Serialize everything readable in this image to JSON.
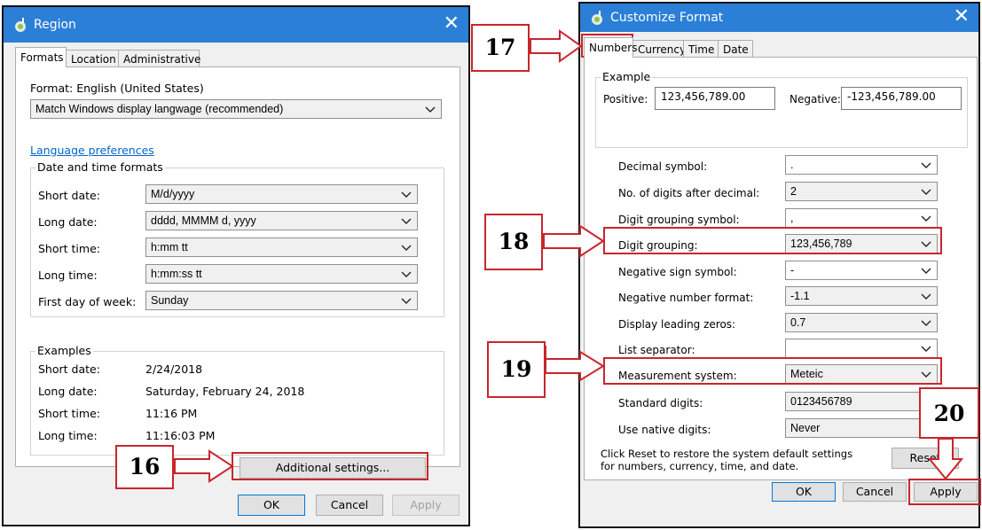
{
  "region_window": {
    "title": "Region",
    "tabs": [
      {
        "label": "Formats",
        "active": true
      },
      {
        "label": "Location",
        "active": false
      },
      {
        "label": "Administrative",
        "active": false
      }
    ],
    "format_label": "Format: English (United States)",
    "format_value": "Match Windows display langwage (recommended)",
    "language_link": "Language preferences",
    "datetime_group": "Date and time formats",
    "fields": [
      {
        "label": "Short date:",
        "value": "M/d/yyyy"
      },
      {
        "label": "Long date:",
        "value": "dddd, MMMM d, yyyy"
      },
      {
        "label": "Short time:",
        "value": "h:mm tt"
      },
      {
        "label": "Long time:",
        "value": "h:mm:ss tt"
      },
      {
        "label": "First day of week:",
        "value": "Sunday"
      }
    ],
    "examples_group": "Examples",
    "examples": [
      {
        "label": "Short date:",
        "value": "2/24/2018"
      },
      {
        "label": "Long date:",
        "value": "Saturday, February 24, 2018"
      },
      {
        "label": "Short time:",
        "value": "11:16 PM"
      },
      {
        "label": "Long time:",
        "value": "11:16:03 PM"
      }
    ],
    "additional_button": "Additional settings...",
    "ok": "OK",
    "cancel": "Cancel",
    "apply": "Apply"
  },
  "customize_window": {
    "title": "Customize Format",
    "tabs": [
      {
        "label": "Numbers",
        "active": true
      },
      {
        "label": "Currency",
        "active": false
      },
      {
        "label": "Time",
        "active": false
      },
      {
        "label": "Date",
        "active": false
      }
    ],
    "example_group": "Example",
    "positive_label": "Positive:",
    "positive_value": "123,456,789.00",
    "negative_label": "Negative:",
    "negative_value": "-123,456,789.00",
    "settings": [
      {
        "label": "Decimal symbol:",
        "value": ".",
        "style": "white"
      },
      {
        "label": "No. of digits after decimal:",
        "value": "2",
        "style": "gray"
      },
      {
        "label": "Digit grouping symbol:",
        "value": ",",
        "style": "white"
      },
      {
        "label": "Digit grouping:",
        "value": "123,456,789",
        "style": "gray"
      },
      {
        "label": "Negative sign symbol:",
        "value": "-",
        "style": "white"
      },
      {
        "label": "Negative number format:",
        "value": "-1.1",
        "style": "gray"
      },
      {
        "label": "Display leading zeros:",
        "value": "0.7",
        "style": "gray"
      },
      {
        "label": "List separator:",
        "value": "",
        "style": "white"
      },
      {
        "label": "Measurement system:",
        "value": "Meteic",
        "style": "gray"
      },
      {
        "label": "Standard digits:",
        "value": "0123456789",
        "style": "gray"
      },
      {
        "label": "Use native digits:",
        "value": "Never",
        "style": "gray"
      }
    ],
    "reset_note": "Click Reset to restore the system default settings for numbers, currency, time, and date.",
    "reset": "Reset",
    "ok": "OK",
    "cancel": "Cancel",
    "apply": "Apply"
  },
  "callouts": [
    "16",
    "17",
    "18",
    "19",
    "20"
  ],
  "colors": {
    "titlebar": "#2b7fd6",
    "callout_red": "#c8262c",
    "link": "#0066cc",
    "window_bg": "#f0f0f0"
  }
}
